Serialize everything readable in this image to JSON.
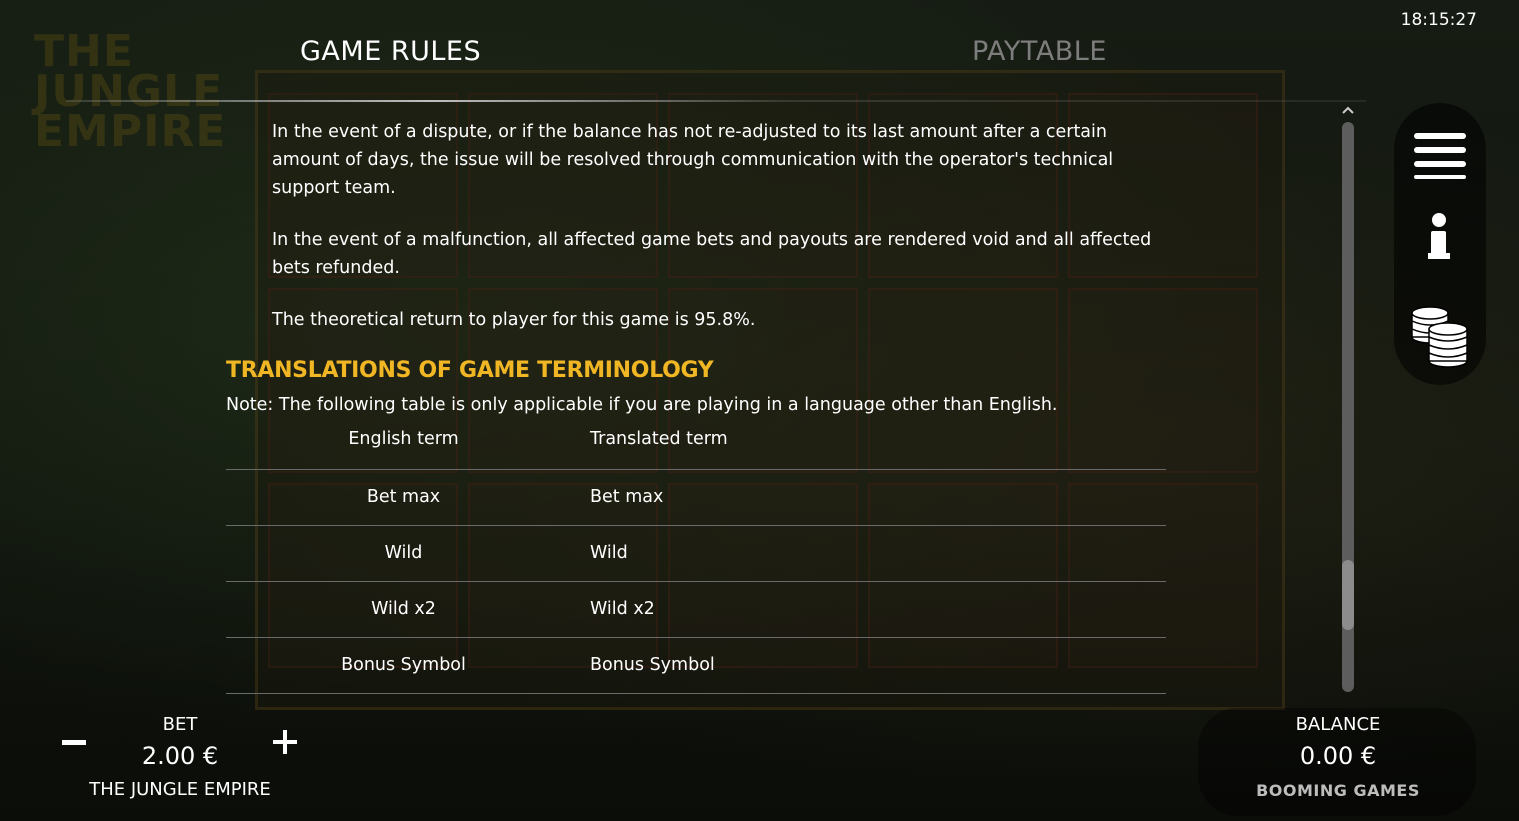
{
  "header": {
    "clock": "18:15:27",
    "tabs": [
      {
        "label": "GAME RULES",
        "active": true
      },
      {
        "label": "PAYTABLE",
        "active": false
      }
    ]
  },
  "rules": {
    "paragraphs": [
      "In the event of a dispute, or if the balance has not re-adjusted to its last amount after a certain amount of days, the issue will be resolved through communication with the operator's technical support team.",
      "In the event of a malfunction, all affected game bets and payouts are rendered void and all affected bets refunded.",
      "The theoretical return to player for this game is 95.8%."
    ],
    "translations": {
      "title": "TRANSLATIONS OF GAME TERMINOLOGY",
      "note": "Note: The following table is only applicable if you are playing in a language other than English.",
      "headers": {
        "english": "English term",
        "translated": "Translated term"
      },
      "rows": [
        {
          "english": "Bet max",
          "translated": "Bet max"
        },
        {
          "english": "Wild",
          "translated": "Wild"
        },
        {
          "english": "Wild x2",
          "translated": "Wild x2"
        },
        {
          "english": "Bonus Symbol",
          "translated": "Bonus Symbol"
        }
      ]
    }
  },
  "side_panel": {
    "icons": [
      "menu-icon",
      "info-icon",
      "coins-icon"
    ]
  },
  "bottom_bar": {
    "bet_label": "BET",
    "bet_value": "2.00 €",
    "game_name": "THE JUNGLE EMPIRE",
    "balance_label": "BALANCE",
    "balance_value": "0.00 €",
    "brand": "BOOMING GAMES"
  },
  "background": {
    "logo_text": "THE JUNGLE EMPIRE"
  },
  "colors": {
    "accent": "#f0b624",
    "inactive_tab": "#7d7d7d",
    "background": "#0e120c"
  }
}
